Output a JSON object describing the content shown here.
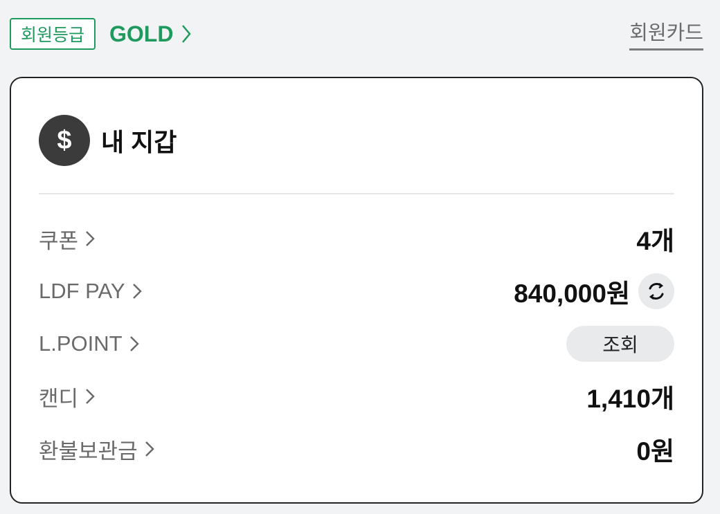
{
  "membership": {
    "badge_label": "회원등급",
    "grade": "GOLD",
    "member_card_link": "회원카드"
  },
  "wallet": {
    "title": "내 지갑",
    "icon_symbol": "$",
    "rows": [
      {
        "label": "쿠폰",
        "value": "4개"
      },
      {
        "label": "LDF PAY",
        "value": "840,000원"
      },
      {
        "label": "L.POINT",
        "button": "조회"
      },
      {
        "label": "캔디",
        "value": "1,410개"
      },
      {
        "label": "환불보관금",
        "value": "0원"
      }
    ]
  },
  "colors": {
    "brand_green": "#1e9a5e",
    "card_border": "#222222",
    "page_background": "#f2f3f5"
  },
  "icons": {
    "wallet": "dollar-icon",
    "chevron": "chevron-right-icon",
    "refresh": "refresh-icon"
  }
}
